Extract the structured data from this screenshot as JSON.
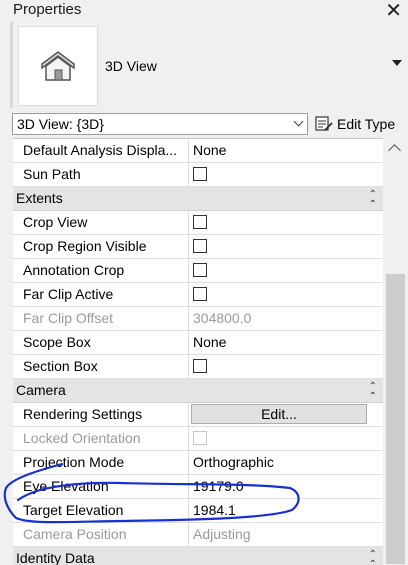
{
  "window": {
    "title": "Properties",
    "close_glyph": "✕"
  },
  "type_selector": {
    "icon": "house-3d-icon",
    "type_name": "3D View"
  },
  "view_selector": {
    "selected": "3D View: {3D}"
  },
  "edit_type": {
    "label": "Edit Type",
    "icon": "edit-type-icon"
  },
  "properties": {
    "top_rows": [
      {
        "name": "Default Analysis Displa...",
        "value": "None"
      },
      {
        "name": "Sun Path",
        "checkbox": false
      }
    ],
    "groups": {
      "extents": {
        "label": "Extents",
        "rows": [
          {
            "name": "Crop View",
            "checkbox": false
          },
          {
            "name": "Crop Region Visible",
            "checkbox": false
          },
          {
            "name": "Annotation Crop",
            "checkbox": false
          },
          {
            "name": "Far Clip Active",
            "checkbox": false
          },
          {
            "name": "Far Clip Offset",
            "value": "304800.0",
            "disabled": true
          },
          {
            "name": "Scope Box",
            "value": "None"
          },
          {
            "name": "Section Box",
            "checkbox": false
          }
        ]
      },
      "camera": {
        "label": "Camera",
        "rows": [
          {
            "name": "Rendering Settings",
            "button": "Edit..."
          },
          {
            "name": "Locked Orientation",
            "checkbox": false,
            "disabled": true
          },
          {
            "name": "Projection Mode",
            "value": "Orthographic"
          },
          {
            "name": "Eye Elevation",
            "value": "19179.0"
          },
          {
            "name": "Target Elevation",
            "value": "1984.1"
          },
          {
            "name": "Camera Position",
            "value": "Adjusting",
            "disabled": true
          }
        ]
      },
      "identity": {
        "label": "Identity Data"
      }
    }
  },
  "annotation": {
    "color": "#1a2fd1"
  }
}
